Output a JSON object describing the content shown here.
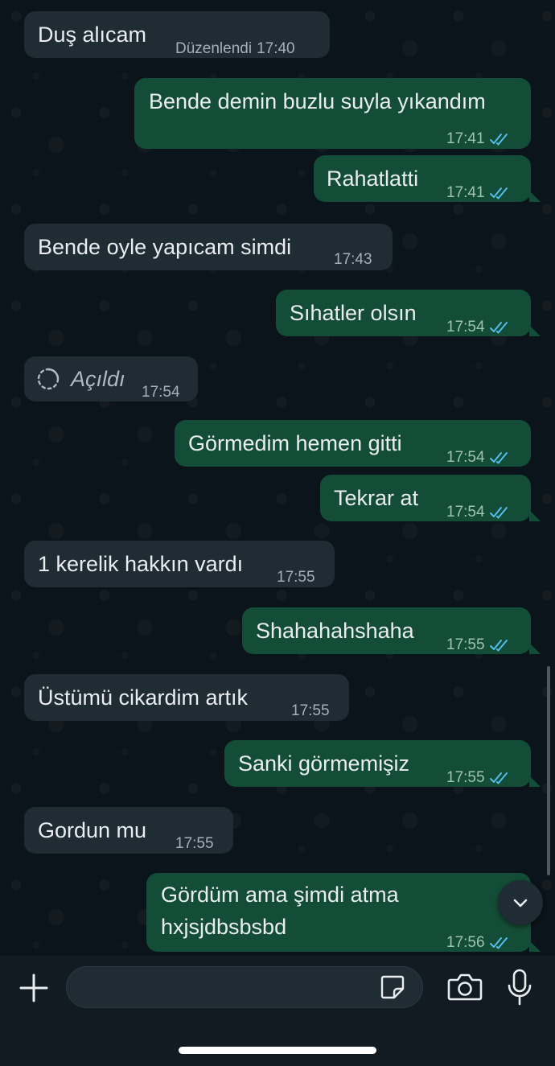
{
  "messages": [
    {
      "dir": "in",
      "text": "Duş alıcam",
      "edited": "Düzenlendi",
      "time": "17:40"
    },
    {
      "dir": "out",
      "text": "Bende demin buzlu suyla yıkandım",
      "time": "17:41"
    },
    {
      "dir": "out",
      "text": "Rahatlatti",
      "time": "17:41"
    },
    {
      "dir": "in",
      "text": "Bende oyle yapıcam simdi",
      "time": "17:43"
    },
    {
      "dir": "out",
      "text": "Sıhatler olsın",
      "time": "17:54"
    },
    {
      "dir": "in",
      "system": true,
      "text": "Açıldı",
      "time": "17:54"
    },
    {
      "dir": "out",
      "text": "Görmedim hemen gitti",
      "time": "17:54"
    },
    {
      "dir": "out",
      "text": "Tekrar at",
      "time": "17:54"
    },
    {
      "dir": "in",
      "text": "1 kerelik hakkın vardı",
      "time": "17:55"
    },
    {
      "dir": "out",
      "text": "Shahahahshaha",
      "time": "17:55"
    },
    {
      "dir": "in",
      "text": "Üstümü cikardim artık",
      "time": "17:55"
    },
    {
      "dir": "out",
      "text": "Sanki görmemişiz",
      "time": "17:55"
    },
    {
      "dir": "in",
      "text": "Gordun mu",
      "time": "17:55"
    },
    {
      "dir": "out",
      "lines": [
        "Gördüm ama şimdi atma",
        "hxjsjdbsbsbd"
      ],
      "time": "17:56"
    }
  ],
  "composer": {
    "placeholder": ""
  },
  "colors": {
    "background": "#0b141a",
    "incoming_bubble": "#1f2c33",
    "outgoing_bubble": "#144d37",
    "read_ticks": "#53bdeb",
    "composer_bar": "#111b21"
  },
  "icons": {
    "read": "double-check-icon",
    "opened": "view-once-opened-icon",
    "scroll": "chevron-down-icon",
    "attach": "plus-icon",
    "sticker": "sticker-icon",
    "camera": "camera-icon",
    "mic": "microphone-icon"
  }
}
